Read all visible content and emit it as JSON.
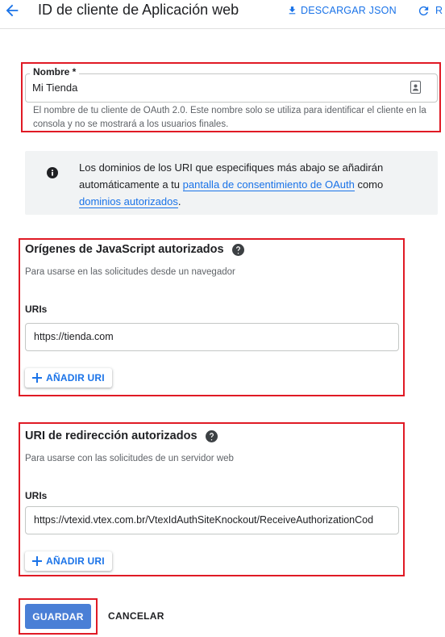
{
  "header": {
    "title": "ID de cliente de Aplicación web",
    "download_label": "DESCARGAR JSON",
    "restart_label": "R",
    "back_icon": "arrow-back-icon",
    "download_icon": "download-icon",
    "restart_icon": "refresh-icon"
  },
  "name_field": {
    "label": "Nombre *",
    "value": "Mi Tienda",
    "help": "El nombre de tu cliente de OAuth 2.0. Este nombre solo se utiliza para identificar el cliente en la consola y no se mostrará a los usuarios finales.",
    "icon": "contact-card-icon"
  },
  "info": {
    "icon": "info-icon",
    "text_before": "Los dominios de los URI que especifiques más abajo se añadirán automáticamente a tu ",
    "link1": "pantalla de consentimiento de OAuth",
    "text_middle": " como ",
    "link2": "dominios autorizados",
    "text_after": "."
  },
  "js_origins": {
    "title": "Orígenes de JavaScript autorizados",
    "subtitle": "Para usarse en las solicitudes desde un navegador",
    "uris_label": "URIs",
    "uri_value": "https://tienda.com",
    "add_label": "AÑADIR URI"
  },
  "redirect_uris": {
    "title": "URI de redirección autorizados",
    "subtitle": "Para usarse con las solicitudes de un servidor web",
    "uris_label": "URIs",
    "uri_value": "https://vtexid.vtex.com.br/VtexIdAuthSiteKnockout/ReceiveAuthorizationCod",
    "add_label": "AÑADIR URI"
  },
  "actions": {
    "save_label": "GUARDAR",
    "cancel_label": "CANCELAR"
  },
  "colors": {
    "accent": "#1a73e8",
    "highlight": "#e01a25",
    "save_button": "#4a7fd6"
  }
}
